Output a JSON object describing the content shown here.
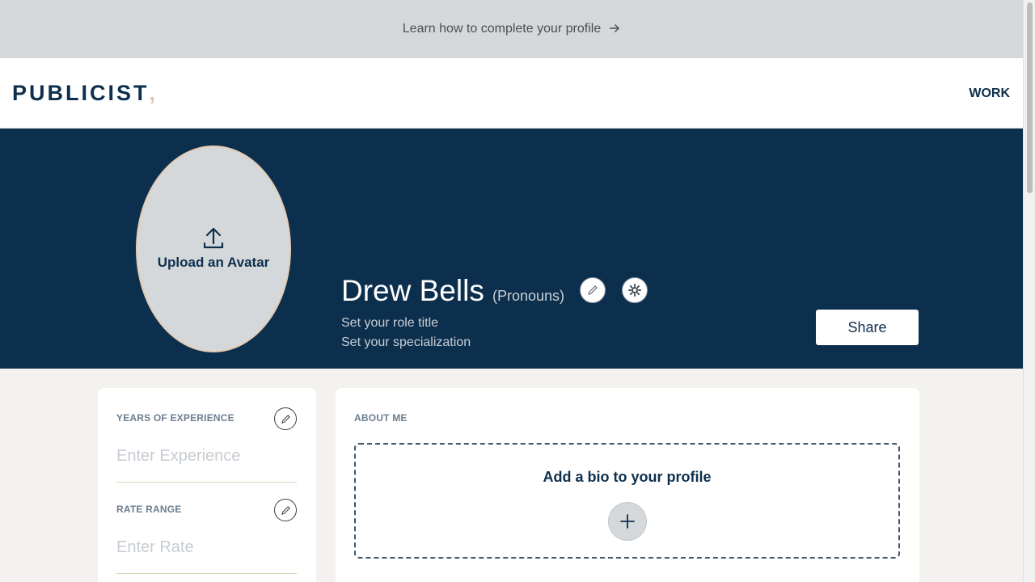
{
  "banner": {
    "text": "Learn how to complete your profile",
    "arrow_icon": "arrow-right-icon"
  },
  "nav": {
    "logo": "PUBLICIST",
    "logo_accent": ",",
    "work_link": "WORK"
  },
  "profile": {
    "avatar_label": "Upload an Avatar",
    "avatar_icon": "upload-icon",
    "name": "Drew Bells",
    "pronouns": "(Pronouns)",
    "role_placeholder": "Set your role title",
    "specialization_placeholder": "Set your specialization",
    "share_label": "Share"
  },
  "left_card": {
    "experience_label": "YEARS OF EXPERIENCE",
    "experience_placeholder": "Enter Experience",
    "rate_label": "RATE RANGE",
    "rate_placeholder": "Enter Rate"
  },
  "about": {
    "label": "ABOUT ME",
    "bio_prompt": "Add a bio to your profile",
    "add_icon": "plus-icon"
  },
  "colors": {
    "hero_bg": "#0c2f4d",
    "banner_bg": "#d5d8db",
    "page_bg": "#f3f2ee",
    "accent": "#d9c8ad"
  }
}
